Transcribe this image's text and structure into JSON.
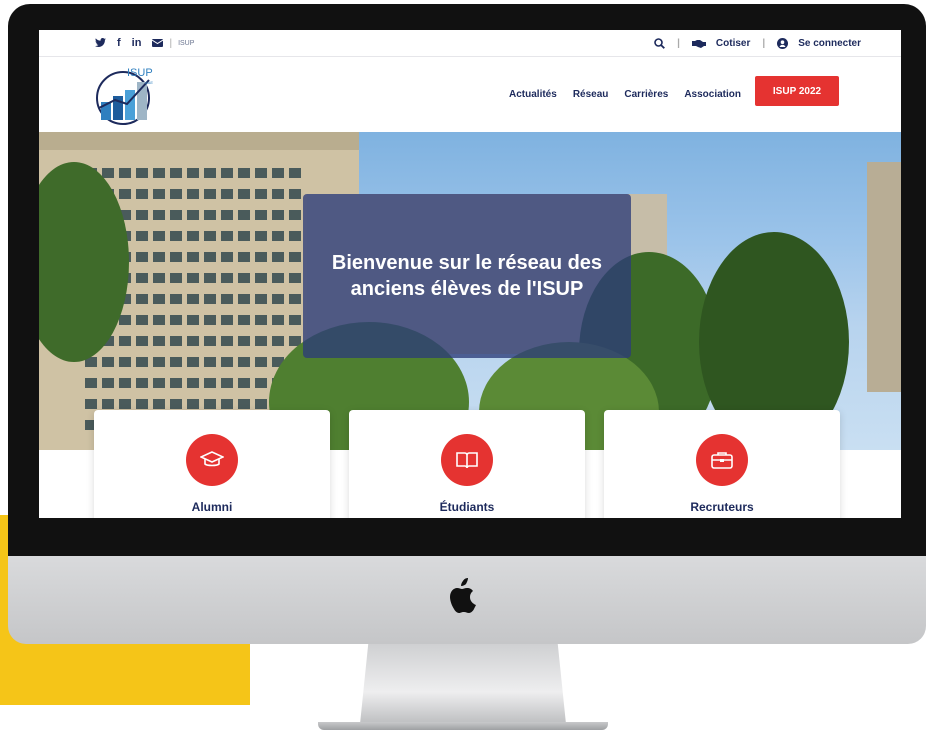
{
  "topbar": {
    "social": [
      "twitter-icon",
      "facebook-icon",
      "linkedin-icon",
      "mail-icon"
    ],
    "facebook_text": "f",
    "linkedin_text": "in",
    "brand_small": "ISUP",
    "cotiser": "Cotiser",
    "connect": "Se connecter"
  },
  "logo": {
    "text": "ISUP",
    "sub": "AAE"
  },
  "nav": {
    "items": [
      "Actualités",
      "Réseau",
      "Carrières",
      "Association"
    ],
    "cta": "ISUP 2022"
  },
  "hero": {
    "title": "Bienvenue sur le réseau des anciens élèves de l'ISUP"
  },
  "cards": [
    {
      "label": "Alumni",
      "icon": "graduation-cap-icon"
    },
    {
      "label": "Étudiants",
      "icon": "book-icon"
    },
    {
      "label": "Recruteurs",
      "icon": "briefcase-icon"
    }
  ],
  "colors": {
    "accent": "#e53331",
    "navy": "#1d2a5c",
    "yellow": "#f5c518"
  }
}
